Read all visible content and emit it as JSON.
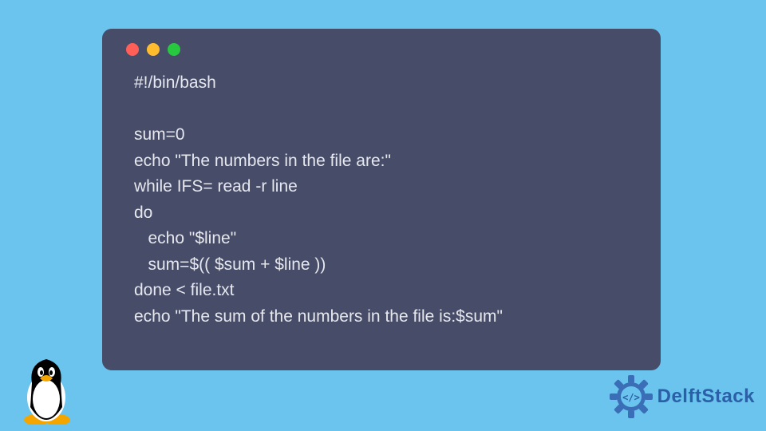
{
  "code": {
    "lines": [
      "#!/bin/bash",
      "",
      "sum=0",
      "echo \"The numbers in the file are:\"",
      "while IFS= read -r line",
      "do",
      "   echo \"$line\"",
      "   sum=$(( $sum + $line ))",
      "done < file.txt",
      "echo \"The sum of the numbers in the file is:$sum\""
    ]
  },
  "brand": {
    "name": "DelftStack"
  },
  "colors": {
    "bg": "#6ac4ed",
    "window": "#474c69",
    "text": "#e6e8ee",
    "brand": "#2b5fa8"
  }
}
